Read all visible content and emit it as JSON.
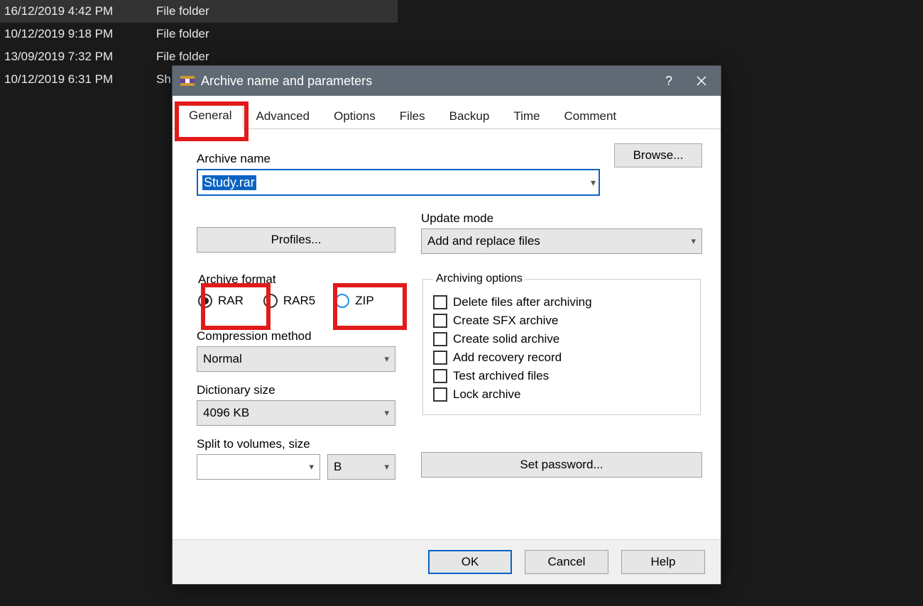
{
  "explorer": {
    "rows": [
      {
        "date": "16/12/2019 4:42 PM",
        "type": "File folder",
        "selected": true
      },
      {
        "date": "10/12/2019 9:18 PM",
        "type": "File folder",
        "selected": false
      },
      {
        "date": "13/09/2019 7:32 PM",
        "type": "File folder",
        "selected": false
      },
      {
        "date": "10/12/2019 6:31 PM",
        "type": "Sh",
        "selected": false
      }
    ]
  },
  "dialog": {
    "title": "Archive name and parameters",
    "tabs": [
      "General",
      "Advanced",
      "Options",
      "Files",
      "Backup",
      "Time",
      "Comment"
    ],
    "active_tab": "General",
    "labels": {
      "archive_name": "Archive name",
      "browse": "Browse...",
      "profiles_btn": "Profiles...",
      "update_mode": "Update mode",
      "archive_format": "Archive format",
      "compression_method": "Compression method",
      "dictionary_size": "Dictionary size",
      "split_volumes": "Split to volumes, size",
      "archiving_options": "Archiving options",
      "set_password": "Set password..."
    },
    "values": {
      "archive_name": "Study.rar",
      "update_mode": "Add and replace files",
      "compression_method": "Normal",
      "dictionary_size": "4096 KB",
      "split_size": "",
      "split_unit": "B"
    },
    "format_options": [
      "RAR",
      "RAR5",
      "ZIP"
    ],
    "selected_format": "RAR",
    "archiving_options": [
      "Delete files after archiving",
      "Create SFX archive",
      "Create solid archive",
      "Add recovery record",
      "Test archived files",
      "Lock archive"
    ],
    "buttons": {
      "ok": "OK",
      "cancel": "Cancel",
      "help": "Help"
    }
  }
}
